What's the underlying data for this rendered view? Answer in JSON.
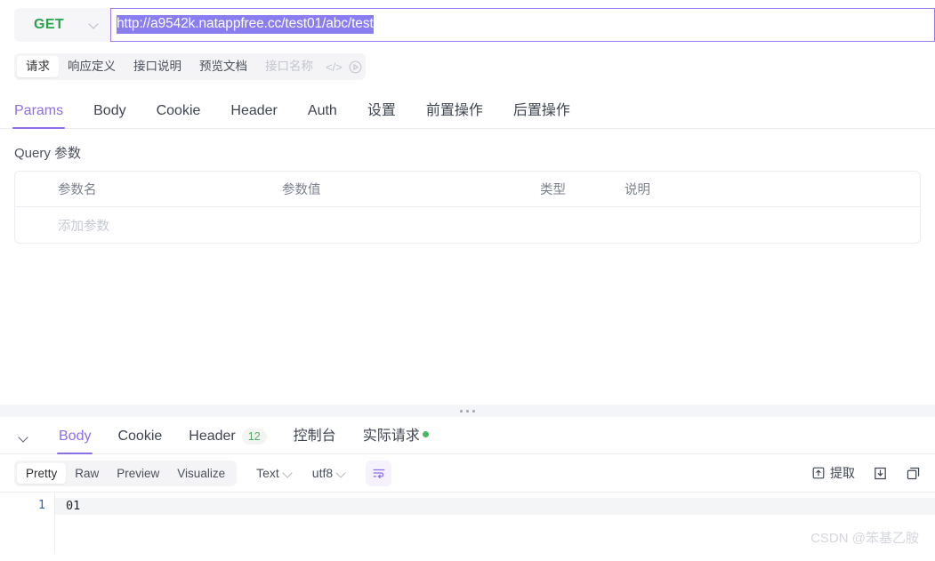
{
  "request_bar": {
    "method": "GET",
    "method_dropdown_icon": "chevron-down-icon",
    "url": "http://a9542k.natappfree.cc/test01/abc/test",
    "url_selected": true
  },
  "sub_tabs": {
    "items": [
      {
        "label": "请求",
        "active": true
      },
      {
        "label": "响应定义",
        "active": false
      },
      {
        "label": "接口说明",
        "active": false
      },
      {
        "label": "预览文档",
        "active": false
      }
    ],
    "muted_label": "接口名称",
    "code_glyph": "</>",
    "icons": [
      "code-icon",
      "clock-run-icon"
    ]
  },
  "main_tabs": [
    {
      "label": "Params",
      "active": true
    },
    {
      "label": "Body",
      "active": false
    },
    {
      "label": "Cookie",
      "active": false
    },
    {
      "label": "Header",
      "active": false
    },
    {
      "label": "Auth",
      "active": false
    },
    {
      "label": "设置",
      "active": false
    },
    {
      "label": "前置操作",
      "active": false
    },
    {
      "label": "后置操作",
      "active": false
    }
  ],
  "query_params": {
    "title": "Query 参数",
    "columns": [
      "参数名",
      "参数值",
      "类型",
      "说明"
    ],
    "rows": [],
    "placeholder_row": "添加参数"
  },
  "splitter": {
    "handle_icon": "drag-dots-icon"
  },
  "response": {
    "collapse_icon": "chevron-down-icon",
    "tabs": [
      {
        "label": "Body",
        "active": true,
        "badge": null,
        "dot": false
      },
      {
        "label": "Cookie",
        "active": false,
        "badge": null,
        "dot": false
      },
      {
        "label": "Header",
        "active": false,
        "badge": "12",
        "dot": false
      },
      {
        "label": "控制台",
        "active": false,
        "badge": null,
        "dot": false
      },
      {
        "label": "实际请求",
        "active": false,
        "badge": null,
        "dot": true
      }
    ],
    "toolbar": {
      "views": [
        {
          "label": "Pretty",
          "active": true
        },
        {
          "label": "Raw",
          "active": false
        },
        {
          "label": "Preview",
          "active": false
        },
        {
          "label": "Visualize",
          "active": false
        }
      ],
      "format_select": "Text",
      "encoding_select": "utf8",
      "wrap_button_icon": "word-wrap-icon",
      "extract_label": "提取",
      "extract_icon": "extract-icon",
      "download_icon": "download-icon",
      "copy_icon": "copy-icon"
    },
    "body": {
      "lines": [
        {
          "number": "1",
          "text": "01"
        }
      ]
    }
  },
  "watermark": "CSDN @笨基乙胺",
  "colors": {
    "accent_purple": "#8c6ee8",
    "method_green": "#2ba24c",
    "badge_green": "#4fae62",
    "status_dot_green": "#43bb5c",
    "selection_purple": "#8a7df0"
  }
}
